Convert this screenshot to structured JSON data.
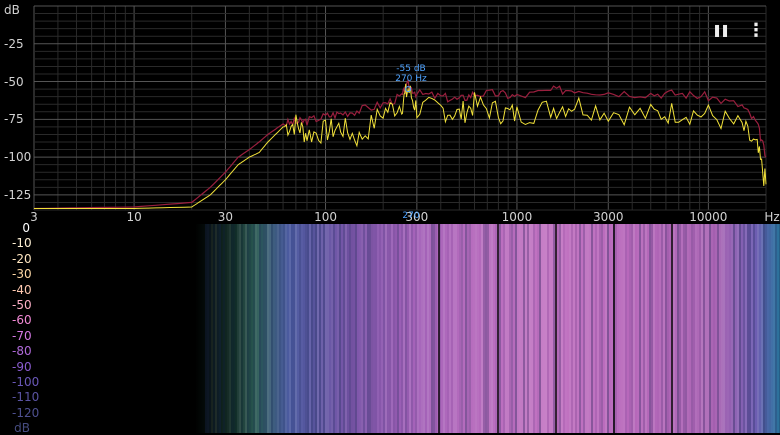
{
  "spectrum": {
    "y_unit": "dB",
    "y_ticks": [
      "-25",
      "-50",
      "-75",
      "-100",
      "-125"
    ],
    "x_unit": "Hz",
    "x_ticks": [
      "3",
      "10",
      "30",
      "100",
      "300",
      "1000",
      "3000",
      "10000"
    ],
    "peak": {
      "db_label": "-55 dB",
      "freq_label": "270 Hz",
      "cursor_label": "270"
    },
    "colors": {
      "current": "#f2e23a",
      "peak_hold": "#9a1f3e",
      "grid": "#3a3a3a",
      "peak_text": "#4fa3ff"
    }
  },
  "controls": {
    "pause_icon": "pause-icon",
    "menu_icon": "more-vertical-icon",
    "pause_glyph": "❚❚",
    "menu_glyph": "⋮"
  },
  "spectrogram": {
    "scale_ticks": [
      "0",
      "-10",
      "-20",
      "-30",
      "-40",
      "-50",
      "-60",
      "-70",
      "-80",
      "-90",
      "-100",
      "-110",
      "-120"
    ],
    "scale_unit": "dB",
    "scale_colors": [
      "#ffffff",
      "#fff2d6",
      "#ffe6c0",
      "#ffd9a6",
      "#ffc9b0",
      "#ffb1c8",
      "#f28ad6",
      "#d57ae6",
      "#b06ad9",
      "#8a5ccf",
      "#6a58b8",
      "#5a53a2",
      "#4e5090",
      "#464c80"
    ]
  },
  "chart_data": {
    "type": "line",
    "xlabel": "Hz",
    "ylabel": "dB",
    "x_scale": "log",
    "xlim": [
      3,
      20000
    ],
    "ylim": [
      -135,
      0
    ],
    "series": [
      {
        "x": [
          3,
          10,
          20,
          25,
          30,
          35,
          40,
          45,
          50,
          60,
          70,
          80,
          100,
          120,
          150,
          200,
          250,
          270,
          300,
          400,
          500,
          600,
          800,
          1000,
          1500,
          2000,
          3000,
          5000,
          7000,
          10000,
          15000,
          18000,
          20000
        ],
        "y": [
          -134,
          -134,
          -133,
          -125,
          -115,
          -105,
          -100,
          -97,
          -90,
          -80,
          -78,
          -85,
          -83,
          -80,
          -88,
          -70,
          -65,
          -55,
          -68,
          -68,
          -72,
          -65,
          -70,
          -72,
          -68,
          -65,
          -70,
          -72,
          -70,
          -72,
          -80,
          -95,
          -118
        ]
      },
      {
        "x": [
          3,
          10,
          20,
          25,
          30,
          35,
          40,
          45,
          50,
          60,
          70,
          80,
          100,
          120,
          150,
          200,
          250,
          270,
          300,
          400,
          500,
          600,
          800,
          1000,
          1500,
          2000,
          3000,
          5000,
          7000,
          10000,
          15000,
          18000,
          20000
        ],
        "y": [
          -134,
          -133,
          -130,
          -120,
          -110,
          -100,
          -95,
          -90,
          -85,
          -78,
          -77,
          -76,
          -73,
          -71,
          -69,
          -65,
          -60,
          -52,
          -58,
          -60,
          -62,
          -58,
          -58,
          -60,
          -56,
          -55,
          -57,
          -58,
          -58,
          -60,
          -66,
          -78,
          -100
        ]
      }
    ]
  }
}
